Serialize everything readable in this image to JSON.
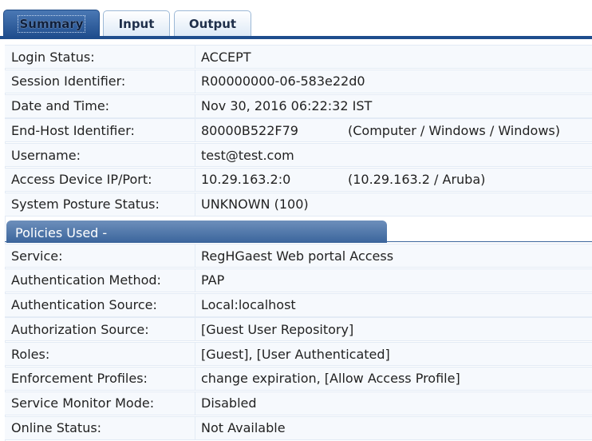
{
  "tabs": [
    {
      "label": "Summary",
      "active": true
    },
    {
      "label": "Input",
      "active": false
    },
    {
      "label": "Output",
      "active": false
    }
  ],
  "summary_rows": [
    {
      "label": "Login Status:",
      "value": "ACCEPT",
      "extra": ""
    },
    {
      "label": "Session Identifier:",
      "value": "R00000000-06-583e22d0",
      "extra": ""
    },
    {
      "label": "Date and Time:",
      "value": "Nov 30, 2016 06:22:32 IST",
      "extra": ""
    },
    {
      "label": "End-Host Identifier:",
      "value": "80000B522F79",
      "extra": "(Computer / Windows / Windows)"
    },
    {
      "label": "Username:",
      "value": "test@test.com",
      "extra": ""
    },
    {
      "label": "Access Device IP/Port:",
      "value": "10.29.163.2:0",
      "extra": "(10.29.163.2 / Aruba)"
    },
    {
      "label": "System Posture Status:",
      "value": "UNKNOWN (100)",
      "extra": ""
    }
  ],
  "policies_header": "Policies Used -",
  "policy_rows": [
    {
      "label": "Service:",
      "value": "RegHGaest Web portal Access"
    },
    {
      "label": "Authentication Method:",
      "value": "PAP"
    },
    {
      "label": "Authentication Source:",
      "value": "Local:localhost"
    },
    {
      "label": "Authorization Source:",
      "value": "[Guest User Repository]"
    },
    {
      "label": "Roles:",
      "value": "[Guest], [User Authenticated]"
    },
    {
      "label": "Enforcement Profiles:",
      "value": "change expiration, [Allow Access Profile]"
    },
    {
      "label": "Service Monitor Mode:",
      "value": "Disabled"
    },
    {
      "label": "Online Status:",
      "value": "Not Available"
    }
  ],
  "colors": {
    "accent": "#1f4d8d",
    "header": "#3b659c",
    "row_bg": "#f6f9fd"
  }
}
